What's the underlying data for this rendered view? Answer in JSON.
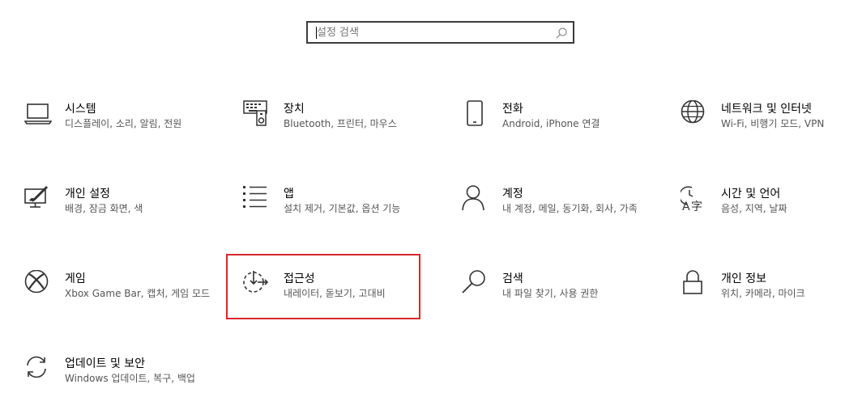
{
  "search": {
    "placeholder": "설정 검색",
    "icon": "search-icon"
  },
  "tiles": [
    {
      "title": "시스템",
      "desc": "디스플레이, 소리, 알림, 전원",
      "icon": "laptop-icon"
    },
    {
      "title": "장치",
      "desc": "Bluetooth, 프린터, 마우스",
      "icon": "devices-icon"
    },
    {
      "title": "전화",
      "desc": "Android, iPhone 연결",
      "icon": "phone-icon"
    },
    {
      "title": "네트워크 및 인터넷",
      "desc": "Wi-Fi, 비행기 모드, VPN",
      "icon": "globe-icon"
    },
    {
      "title": "개인 설정",
      "desc": "배경, 잠금 화면, 색",
      "icon": "paint-icon"
    },
    {
      "title": "앱",
      "desc": "설치 제거, 기본값, 옵션 기능",
      "icon": "apps-list-icon"
    },
    {
      "title": "계정",
      "desc": "내 계정, 메일, 동기화, 회사, 가족",
      "icon": "person-icon"
    },
    {
      "title": "시간 및 언어",
      "desc": "음성, 지역, 날짜",
      "icon": "time-language-icon"
    },
    {
      "title": "게임",
      "desc": "Xbox Game Bar, 캡처, 게임 모드",
      "icon": "xbox-icon"
    },
    {
      "title": "접근성",
      "desc": "내레이터, 돋보기, 고대비",
      "icon": "accessibility-icon"
    },
    {
      "title": "검색",
      "desc": "내 파일 찾기, 사용 권한",
      "icon": "search-icon"
    },
    {
      "title": "개인 정보",
      "desc": "위치, 카메라, 마이크",
      "icon": "lock-icon"
    },
    {
      "title": "업데이트 및 보안",
      "desc": "Windows 업데이트, 복구, 백업",
      "icon": "sync-icon"
    }
  ]
}
